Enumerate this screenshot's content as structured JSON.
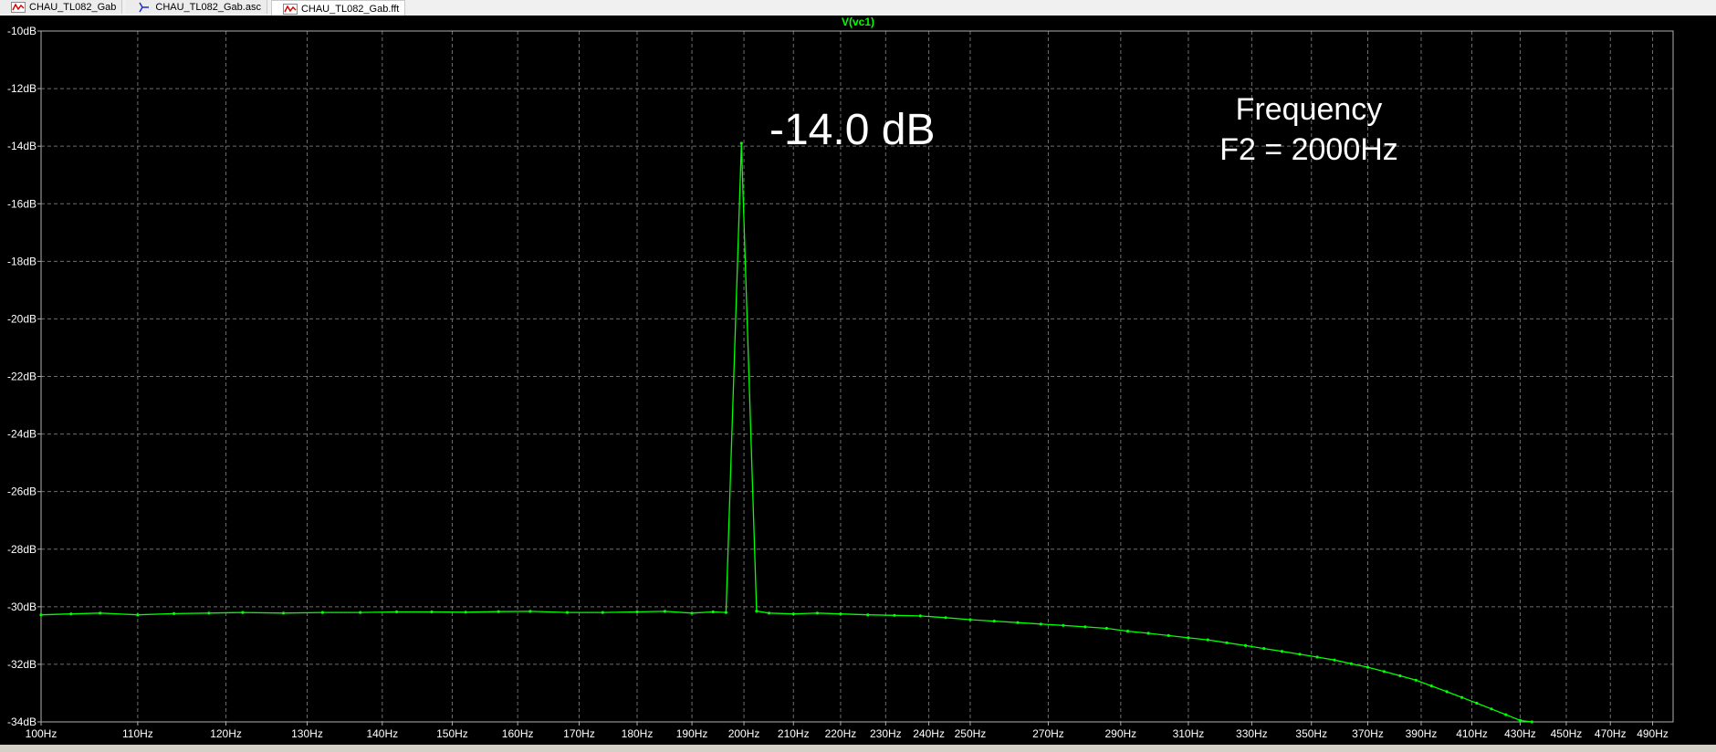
{
  "tabs": [
    {
      "label": "CHAU_TL082_Gab",
      "icon": "waveform-icon",
      "active": false
    },
    {
      "label": "CHAU_TL082_Gab.asc",
      "icon": "schematic-icon",
      "active": false
    },
    {
      "label": "CHAU_TL082_Gab.fft",
      "icon": "waveform-icon",
      "active": true
    }
  ],
  "colors": {
    "plot_bg": "#000000",
    "trace": "#00ff00",
    "grid": "#6e6e6e",
    "tick_text": "#ffffff",
    "annotation_text": "#ffffff",
    "trace_title": "#00ff00"
  },
  "annotations": {
    "peak_label": "-14.0 dB",
    "freq_line1": "Frequency",
    "freq_line2": "F2 = 2000Hz"
  },
  "chart_data": {
    "type": "line",
    "title": "V(vc1)",
    "xlabel": "",
    "ylabel": "",
    "x_scale": "log",
    "xlim": [
      100,
      500
    ],
    "ylim": [
      -34,
      -10
    ],
    "grid": true,
    "legend": "none",
    "x_ticks": [
      100,
      110,
      120,
      130,
      140,
      150,
      160,
      170,
      180,
      190,
      200,
      210,
      220,
      230,
      240,
      250,
      270,
      290,
      310,
      330,
      350,
      370,
      390,
      410,
      430,
      450,
      470,
      490
    ],
    "x_tick_labels": [
      "100Hz",
      "110Hz",
      "120Hz",
      "130Hz",
      "140Hz",
      "150Hz",
      "160Hz",
      "170Hz",
      "180Hz",
      "190Hz",
      "200Hz",
      "210Hz",
      "220Hz",
      "230Hz",
      "240Hz",
      "250Hz",
      "270Hz",
      "290Hz",
      "310Hz",
      "330Hz",
      "350Hz",
      "370Hz",
      "390Hz",
      "410Hz",
      "430Hz",
      "450Hz",
      "470Hz",
      "490Hz"
    ],
    "y_ticks": [
      -10,
      -12,
      -14,
      -16,
      -18,
      -20,
      -22,
      -24,
      -26,
      -28,
      -30,
      -32,
      -34
    ],
    "y_tick_labels": [
      "-10dB",
      "-12dB",
      "-14dB",
      "-16dB",
      "-18dB",
      "-20dB",
      "-22dB",
      "-24dB",
      "-26dB",
      "-28dB",
      "-30dB",
      "-32dB",
      "-34dB"
    ],
    "series": [
      {
        "name": "V(vc1)",
        "x": [
          100,
          103,
          106,
          110,
          114,
          118,
          122,
          127,
          132,
          137,
          142,
          147,
          152,
          157,
          162,
          168,
          174,
          180,
          185,
          190,
          194,
          196.5,
          199.5,
          202.5,
          205,
          210,
          215,
          220,
          226,
          232,
          238,
          244,
          250,
          256,
          262,
          268,
          274,
          280,
          286,
          292,
          298,
          304,
          310,
          316,
          322,
          328,
          334,
          340,
          346,
          352,
          358,
          364,
          370,
          376,
          382,
          388,
          394,
          400,
          406,
          412,
          418,
          424,
          430,
          435
        ],
        "y": [
          -30.28,
          -30.25,
          -30.22,
          -30.28,
          -30.24,
          -30.22,
          -30.2,
          -30.22,
          -30.2,
          -30.2,
          -30.18,
          -30.18,
          -30.19,
          -30.17,
          -30.16,
          -30.2,
          -30.2,
          -30.18,
          -30.16,
          -30.22,
          -30.18,
          -30.2,
          -13.9,
          -30.15,
          -30.22,
          -30.25,
          -30.22,
          -30.25,
          -30.28,
          -30.3,
          -30.32,
          -30.38,
          -30.45,
          -30.5,
          -30.55,
          -30.6,
          -30.65,
          -30.7,
          -30.75,
          -30.85,
          -30.92,
          -31.0,
          -31.08,
          -31.15,
          -31.25,
          -31.35,
          -31.45,
          -31.55,
          -31.65,
          -31.75,
          -31.85,
          -31.98,
          -32.1,
          -32.25,
          -32.4,
          -32.55,
          -32.75,
          -32.95,
          -33.15,
          -33.35,
          -33.55,
          -33.75,
          -33.95,
          -34.0
        ]
      }
    ]
  }
}
